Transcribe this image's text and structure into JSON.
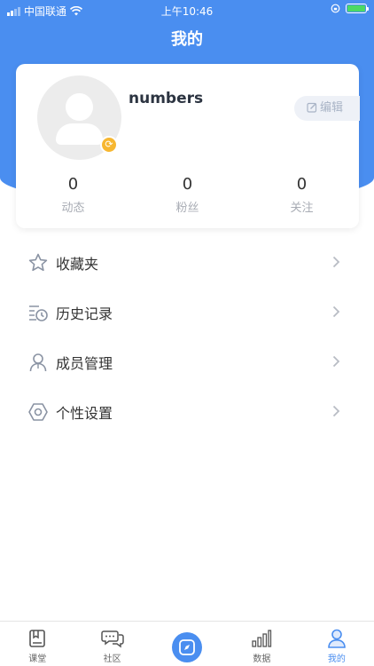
{
  "status_bar": {
    "carrier": "中国联通",
    "time": "上午10:46",
    "battery_color": "#4cd964"
  },
  "header": {
    "title": "我的",
    "bg_color": "#4a8ef0"
  },
  "profile": {
    "username": "numbers",
    "edit_label": "编辑",
    "avatar_icon": "user-avatar-icon",
    "badge_icon": "refresh-icon",
    "stats": [
      {
        "value": "0",
        "label": "动态"
      },
      {
        "value": "0",
        "label": "粉丝"
      },
      {
        "value": "0",
        "label": "关注"
      }
    ]
  },
  "menu": [
    {
      "label": "收藏夹",
      "icon": "star-icon"
    },
    {
      "label": "历史记录",
      "icon": "history-icon"
    },
    {
      "label": "成员管理",
      "icon": "member-icon"
    },
    {
      "label": "个性设置",
      "icon": "settings-icon"
    }
  ],
  "tabbar": {
    "active_color": "#4a8ef0",
    "tabs": [
      {
        "label": "课堂",
        "icon": "book-icon"
      },
      {
        "label": "社区",
        "icon": "chat-icon"
      },
      {
        "label": "",
        "icon": "compass-icon"
      },
      {
        "label": "数据",
        "icon": "bar-chart-icon"
      },
      {
        "label": "我的",
        "icon": "user-icon"
      }
    ]
  }
}
